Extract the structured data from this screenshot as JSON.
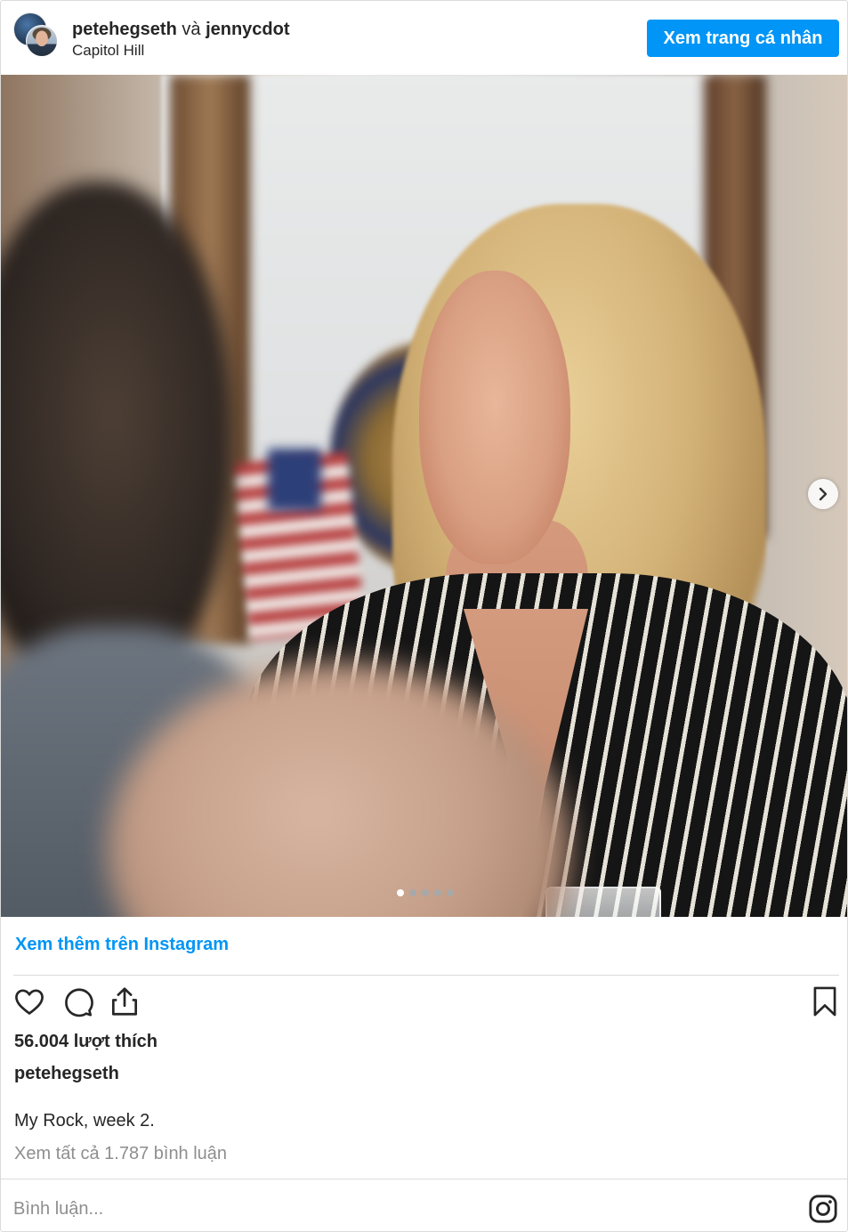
{
  "header": {
    "user1": "petehegseth",
    "connector": "và",
    "user2": "jennycdot",
    "location": "Capitol Hill",
    "profile_button": "Xem trang cá nhân"
  },
  "carousel": {
    "total_slides": 5,
    "active_slide": 1
  },
  "links": {
    "view_more": "Xem thêm trên Instagram"
  },
  "stats": {
    "likes": "56.004 lượt thích"
  },
  "post": {
    "owner": "petehegseth",
    "caption": "My Rock, week 2.",
    "view_comments": "Xem tất cả 1.787 bình luận"
  },
  "comment": {
    "placeholder": "Bình luận..."
  },
  "colors": {
    "accent": "#0095f6",
    "text": "#262626",
    "muted": "#8e8e8e",
    "border": "#dbdbdb"
  },
  "icons": [
    "heart-icon",
    "comment-icon",
    "share-icon",
    "bookmark-icon",
    "chevron-right-icon",
    "instagram-icon"
  ]
}
